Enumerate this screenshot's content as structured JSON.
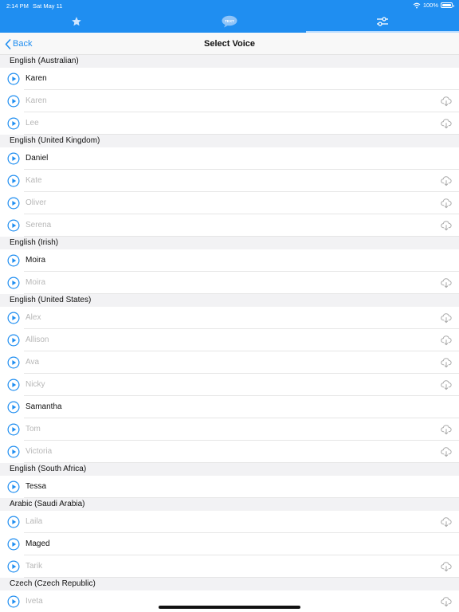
{
  "status": {
    "time": "2:14 PM",
    "date": "Sat May 11",
    "battery": "100%"
  },
  "tabs": [
    {
      "icon": "star-icon",
      "active": false
    },
    {
      "icon": "speech-bubble-icon",
      "badge": "TEXT",
      "active": false
    },
    {
      "icon": "sliders-icon",
      "active": true
    }
  ],
  "nav": {
    "back_label": "Back",
    "title": "Select Voice"
  },
  "colors": {
    "accent": "#1f8ef1",
    "unavailable": "#b7b7b7"
  },
  "sections": [
    {
      "title": "English (Australian)",
      "voices": [
        {
          "name": "Karen",
          "available": true
        },
        {
          "name": "Karen",
          "available": false
        },
        {
          "name": "Lee",
          "available": false
        }
      ]
    },
    {
      "title": "English (United Kingdom)",
      "voices": [
        {
          "name": "Daniel",
          "available": true
        },
        {
          "name": "Kate",
          "available": false
        },
        {
          "name": "Oliver",
          "available": false
        },
        {
          "name": "Serena",
          "available": false
        }
      ]
    },
    {
      "title": "English (Irish)",
      "voices": [
        {
          "name": "Moira",
          "available": true
        },
        {
          "name": "Moira",
          "available": false
        }
      ]
    },
    {
      "title": "English (United States)",
      "voices": [
        {
          "name": "Alex",
          "available": false
        },
        {
          "name": "Allison",
          "available": false
        },
        {
          "name": "Ava",
          "available": false
        },
        {
          "name": "Nicky",
          "available": false
        },
        {
          "name": "Samantha",
          "available": true
        },
        {
          "name": "Tom",
          "available": false
        },
        {
          "name": "Victoria",
          "available": false
        }
      ]
    },
    {
      "title": "English (South Africa)",
      "voices": [
        {
          "name": "Tessa",
          "available": true
        }
      ]
    },
    {
      "title": "Arabic (Saudi Arabia)",
      "voices": [
        {
          "name": "Laila",
          "available": false
        },
        {
          "name": "Maged",
          "available": true
        },
        {
          "name": "Tarik",
          "available": false
        }
      ]
    },
    {
      "title": "Czech (Czech Republic)",
      "voices": [
        {
          "name": "Iveta",
          "available": false
        }
      ]
    }
  ]
}
